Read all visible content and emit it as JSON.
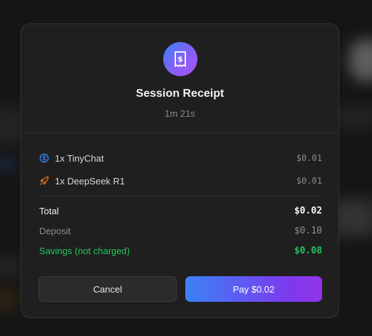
{
  "receipt": {
    "title": "Session Receipt",
    "duration": "1m 21s",
    "items": [
      {
        "label": "1x TinyChat",
        "price": "$0.01",
        "icon": "brain-icon",
        "icon_color": "#3b82f6"
      },
      {
        "label": "1x DeepSeek R1",
        "price": "$0.01",
        "icon": "rocket-icon",
        "icon_color": "#f97316"
      }
    ],
    "summary": {
      "total_label": "Total",
      "total_value": "$0.02",
      "deposit_label": "Deposit",
      "deposit_value": "$0.10",
      "savings_label": "Savings (not charged)",
      "savings_value": "$0.08"
    },
    "buttons": {
      "cancel": "Cancel",
      "pay": "Pay $0.02"
    }
  },
  "colors": {
    "accent_blue": "#3b82f6",
    "accent_purple": "#9333ea",
    "savings_green": "#22c55e",
    "modal_bg": "#1f1f1f"
  }
}
